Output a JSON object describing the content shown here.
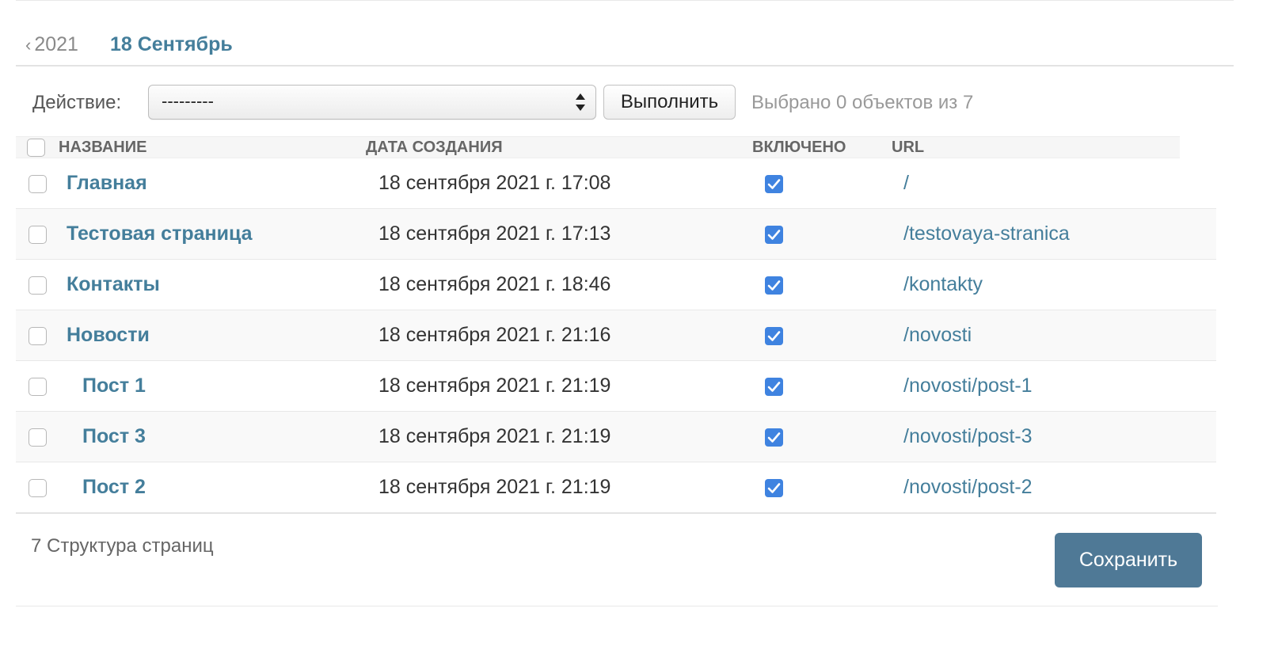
{
  "date_hierarchy": {
    "back_label": "2021",
    "current_label": "18 Сентябрь"
  },
  "actions": {
    "label": "Действие:",
    "select_value": "---------",
    "go_label": "Выполнить",
    "selection_counter": "Выбрано 0 объектов из 7"
  },
  "table": {
    "headers": {
      "name": "Название",
      "created": "Дата создания",
      "enabled": "Включено",
      "url": "URL"
    },
    "rows": [
      {
        "name": "Главная",
        "created": "18 сентября 2021 г. 17:08",
        "enabled": true,
        "url": "/",
        "indented": false
      },
      {
        "name": "Тестовая страница",
        "created": "18 сентября 2021 г. 17:13",
        "enabled": true,
        "url": "/testovaya-stranica",
        "indented": false
      },
      {
        "name": "Контакты",
        "created": "18 сентября 2021 г. 18:46",
        "enabled": true,
        "url": "/kontakty",
        "indented": false
      },
      {
        "name": "Новости",
        "created": "18 сентября 2021 г. 21:16",
        "enabled": true,
        "url": "/novosti",
        "indented": false
      },
      {
        "name": "Пост 1",
        "created": "18 сентября 2021 г. 21:19",
        "enabled": true,
        "url": "/novosti/post-1",
        "indented": true
      },
      {
        "name": "Пост 3",
        "created": "18 сентября 2021 г. 21:19",
        "enabled": true,
        "url": "/novosti/post-3",
        "indented": true
      },
      {
        "name": "Пост 2",
        "created": "18 сентября 2021 г. 21:19",
        "enabled": true,
        "url": "/novosti/post-2",
        "indented": true
      }
    ]
  },
  "footer": {
    "paginator": "7 Структура страниц",
    "save_label": "Сохранить"
  },
  "colors": {
    "link": "#447e9b",
    "save_button": "#4f7996",
    "checkbox_checked": "#3f83e0"
  }
}
